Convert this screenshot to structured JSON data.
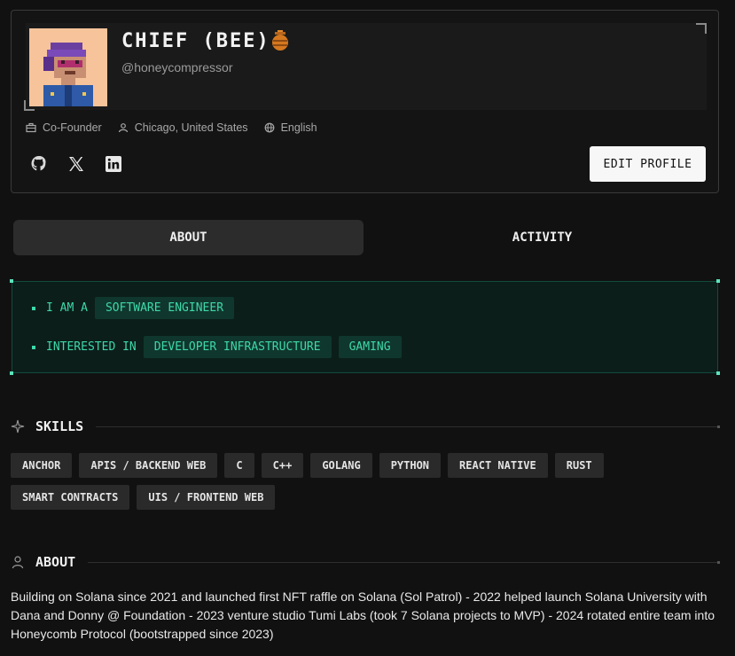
{
  "profile": {
    "name": "CHIEF (BEE)",
    "handle": "@honeycompressor",
    "role": "Co-Founder",
    "location": "Chicago, United States",
    "language": "English",
    "edit_label": "EDIT PROFILE",
    "socials": [
      "github-icon",
      "x-icon",
      "linkedin-icon"
    ]
  },
  "tabs": [
    {
      "label": "ABOUT",
      "active": true
    },
    {
      "label": "ACTIVITY",
      "active": false
    }
  ],
  "interests": {
    "row1_prefix": "I AM A",
    "row1_chips": [
      "SOFTWARE ENGINEER"
    ],
    "row2_prefix": "INTERESTED IN",
    "row2_chips": [
      "DEVELOPER INFRASTRUCTURE",
      "GAMING"
    ]
  },
  "skills_section": {
    "title": "SKILLS",
    "items": [
      "ANCHOR",
      "APIS / BACKEND WEB",
      "C",
      "C++",
      "GOLANG",
      "PYTHON",
      "REACT NATIVE",
      "RUST",
      "SMART CONTRACTS",
      "UIS / FRONTEND WEB"
    ]
  },
  "about_section": {
    "title": "ABOUT",
    "bio": "Building on Solana since 2021 and launched first NFT raffle on Solana (Sol Patrol) - 2022 helped launch Solana University with Dana and Donny @ Foundation - 2023 venture studio Tumi Labs (took 7 Solana projects to MVP) - 2024 rotated entire team into Honeycomb Protocol (bootstrapped since 2023)"
  },
  "colors": {
    "accent_green": "#3ed8a9",
    "background": "#111111"
  }
}
